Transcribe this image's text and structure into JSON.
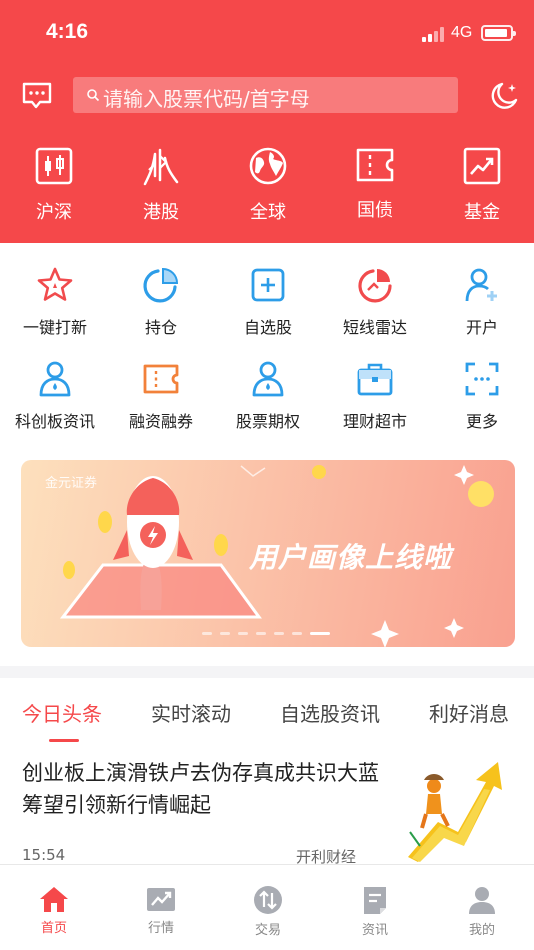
{
  "status_bar": {
    "time": "4:16",
    "network": "4G"
  },
  "header": {
    "search_placeholder": "请输入股票代码/首字母"
  },
  "market_nav": [
    {
      "label": "沪深",
      "icon": "candlestick-icon"
    },
    {
      "label": "港股",
      "icon": "hk-skyline-icon"
    },
    {
      "label": "全球",
      "icon": "globe-icon"
    },
    {
      "label": "国债",
      "icon": "ticket-icon"
    },
    {
      "label": "基金",
      "icon": "trend-chart-icon"
    }
  ],
  "quick_grid": [
    {
      "label": "一键打新",
      "icon": "star-icon"
    },
    {
      "label": "持仓",
      "icon": "pie-chart-icon"
    },
    {
      "label": "自选股",
      "icon": "add-square-icon"
    },
    {
      "label": "短线雷达",
      "icon": "radar-icon"
    },
    {
      "label": "开户",
      "icon": "add-user-icon"
    },
    {
      "label": "科创板资讯",
      "icon": "user-info-icon"
    },
    {
      "label": "融资融券",
      "icon": "coupon-icon"
    },
    {
      "label": "股票期权",
      "icon": "user-option-icon"
    },
    {
      "label": "理财超市",
      "icon": "briefcase-icon"
    },
    {
      "label": "更多",
      "icon": "scan-icon"
    }
  ],
  "banner": {
    "brand": "金元证券",
    "message": "用户画像上线啦"
  },
  "news_tabs": [
    "今日头条",
    "实时滚动",
    "自选股资讯",
    "利好消息"
  ],
  "news": {
    "headline": "创业板上演滑铁卢去伪存真成共识大蓝筹望引领新行情崛起",
    "time": "15:54",
    "source": "开利财经"
  },
  "tab_bar": [
    {
      "label": "首页",
      "icon": "home-icon"
    },
    {
      "label": "行情",
      "icon": "market-icon"
    },
    {
      "label": "交易",
      "icon": "trade-icon"
    },
    {
      "label": "资讯",
      "icon": "news-icon"
    },
    {
      "label": "我的",
      "icon": "profile-icon"
    }
  ],
  "colors": {
    "brand_red": "#f5484a",
    "icon_blue": "#2d9de8",
    "icon_orange": "#f2813a",
    "icon_red": "#f14b4d"
  }
}
